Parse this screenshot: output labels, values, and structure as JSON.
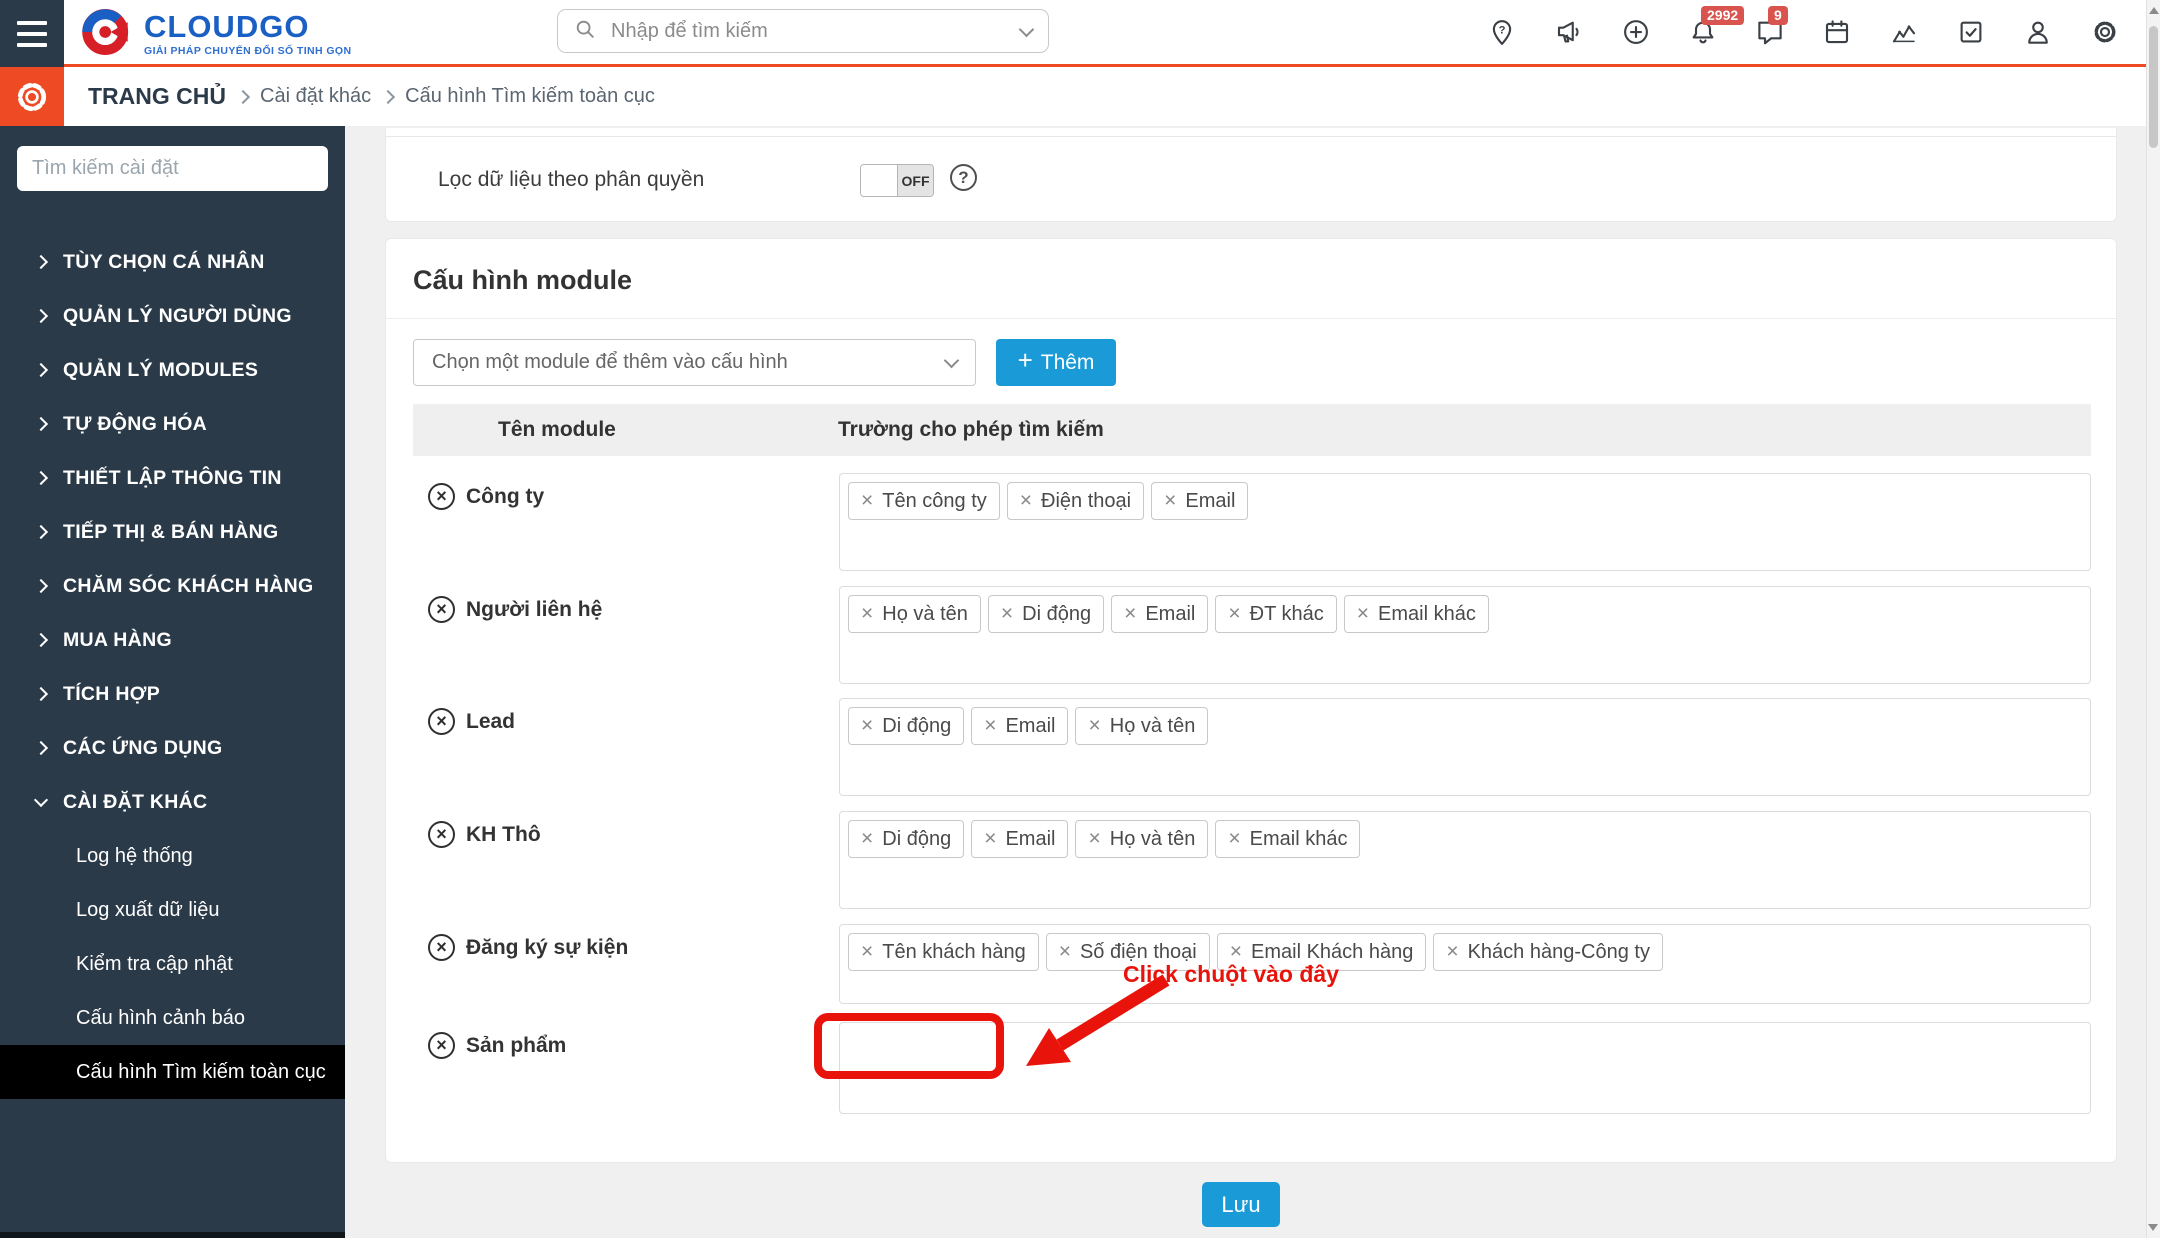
{
  "header": {
    "logo_text": "CLOUDGO",
    "logo_tagline": "GIẢI PHÁP CHUYỂN ĐỔI SỐ TINH GỌN",
    "search_placeholder": "Nhập để tìm kiếm",
    "notification_badge": "2992",
    "chat_badge": "9"
  },
  "breadcrumb": {
    "home": "TRANG CHỦ",
    "items": [
      "Cài đặt khác",
      "Cấu hình Tìm kiếm toàn cục"
    ]
  },
  "sidebar": {
    "search_placeholder": "Tìm kiếm cài đặt",
    "items": [
      {
        "label": "TÙY CHỌN CÁ NHÂN"
      },
      {
        "label": "QUẢN LÝ NGƯỜI DÙNG"
      },
      {
        "label": "QUẢN LÝ MODULES"
      },
      {
        "label": "TỰ ĐỘNG HÓA"
      },
      {
        "label": "THIẾT LẬP THÔNG TIN"
      },
      {
        "label": "TIẾP THỊ & BÁN HÀNG"
      },
      {
        "label": "CHĂM SÓC KHÁCH HÀNG"
      },
      {
        "label": "MUA HÀNG"
      },
      {
        "label": "TÍCH HỢP"
      },
      {
        "label": "CÁC ỨNG DỤNG"
      },
      {
        "label": "CÀI ĐẶT KHÁC"
      }
    ],
    "sub_items": [
      {
        "label": "Log hệ thống"
      },
      {
        "label": "Log xuất dữ liệu"
      },
      {
        "label": "Kiểm tra cập nhật"
      },
      {
        "label": "Cấu hình cảnh báo"
      },
      {
        "label": "Cấu hình Tìm kiếm toàn cục"
      }
    ]
  },
  "content": {
    "permission_filter_label": "Lọc dữ liệu theo phân quyền",
    "toggle_state": "OFF",
    "module_config_title": "Cấu hình module",
    "module_select_placeholder": "Chọn một module để thêm vào cấu hình",
    "add_button_label": "Thêm",
    "table_headers": [
      "Tên module",
      "Trường cho phép tìm kiếm"
    ],
    "rows": [
      {
        "module": "Công ty",
        "fields": [
          "Tên công ty",
          "Điện thoại",
          "Email"
        ]
      },
      {
        "module": "Người liên hệ",
        "fields": [
          "Họ và tên",
          "Di động",
          "Email",
          "ĐT khác",
          "Email khác"
        ]
      },
      {
        "module": "Lead",
        "fields": [
          "Di động",
          "Email",
          "Họ và tên"
        ]
      },
      {
        "module": "KH Thô",
        "fields": [
          "Di động",
          "Email",
          "Họ và tên",
          "Email khác"
        ]
      },
      {
        "module": "Đăng ký sự kiện",
        "fields": [
          "Tên khách hàng",
          "Số điện thoại",
          "Email Khách hàng",
          "Khách hàng-Công ty"
        ]
      },
      {
        "module": "Sản phẩm",
        "fields": []
      }
    ],
    "annotation_text": "Click chuột vào đây",
    "save_button_label": "Lưu"
  },
  "colors": {
    "accent_orange": "#ee4a23",
    "sidebar_navy": "#2b3a48",
    "primary_blue": "#1a9bd7",
    "annotation_red": "#e8140c",
    "badge_red": "#d9534f",
    "logo_blue": "#1a5fc4"
  }
}
